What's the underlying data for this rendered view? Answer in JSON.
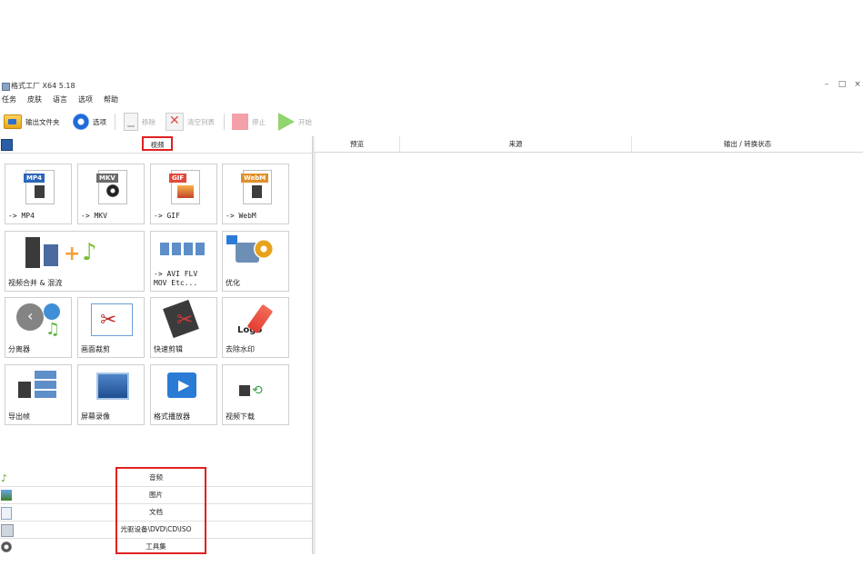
{
  "window": {
    "title": "格式工厂 X64 5.18",
    "controls": [
      "–",
      "□",
      "×"
    ]
  },
  "menu": [
    "任务",
    "皮肤",
    "语言",
    "选项",
    "帮助"
  ],
  "toolbar": {
    "output_folder": "输出文件夹",
    "options": "选项",
    "remove": "移除",
    "clear_list": "清空列表",
    "stop": "停止",
    "start": "开始"
  },
  "video_category": {
    "label": "视频",
    "tiles": [
      {
        "caption": "-> MP4",
        "tag": "MP4",
        "tag_color": "#2b66b8"
      },
      {
        "caption": "-> MKV",
        "tag": "MKV",
        "tag_color": "#6b6b6b"
      },
      {
        "caption": "-> GIF",
        "tag": "GIF",
        "tag_color": "#e2473c"
      },
      {
        "caption": "-> WebM",
        "tag": "WebM",
        "tag_color": "#e0902a"
      },
      {
        "caption": "视频合并 & 混流"
      },
      {
        "caption": "-> AVI FLV\nMOV Etc..."
      },
      {
        "caption": "优化"
      },
      {
        "caption": "分离器"
      },
      {
        "caption": "画面裁剪"
      },
      {
        "caption": "快速剪辑"
      },
      {
        "caption": "去除水印",
        "logo_text": "Logo"
      },
      {
        "caption": "导出帧"
      },
      {
        "caption": "屏幕录像"
      },
      {
        "caption": "格式播放器"
      },
      {
        "caption": "视频下载"
      }
    ]
  },
  "other_categories": [
    {
      "label": "音频",
      "icon": "music-note-icon"
    },
    {
      "label": "图片",
      "icon": "image-icon"
    },
    {
      "label": "文档",
      "icon": "document-icon"
    },
    {
      "label": "光驱设备\\DVD\\CD\\ISO",
      "icon": "disc-drive-icon"
    },
    {
      "label": "工具集",
      "icon": "toolbox-icon"
    }
  ],
  "task_list": {
    "columns": [
      "预览",
      "来源",
      "输出 / 转换状态"
    ]
  }
}
